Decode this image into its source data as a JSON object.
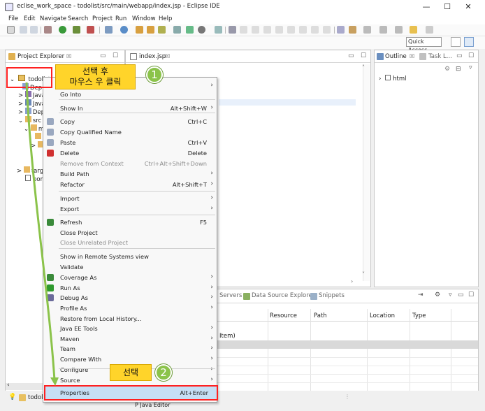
{
  "window": {
    "title": "eclise_work_space - todolist/src/main/webapp/index.jsp - Eclipse IDE",
    "minimize": "—",
    "maximize": "☐",
    "close": "✕"
  },
  "menubar": [
    "File",
    "Edit",
    "Navigate",
    "Search",
    "Project",
    "Run",
    "Window",
    "Help"
  ],
  "toolbar": {
    "quick_access_placeholder": "Quick Access"
  },
  "project_explorer": {
    "tab_label": "Project Explorer",
    "tab_close": "☒",
    "tree": [
      {
        "label": "todolist",
        "expander": "⌄"
      },
      {
        "label": "Dep",
        "expander": ""
      },
      {
        "label": "Java",
        "expander": ">"
      },
      {
        "label": "Java",
        "expander": ">"
      },
      {
        "label": "Dep",
        "expander": ">"
      },
      {
        "label": "src",
        "expander": "⌄"
      },
      {
        "label": "m",
        "expander": "⌄"
      },
      {
        "label": "",
        "expander": ""
      },
      {
        "label": "",
        "expander": ">"
      },
      {
        "label": "targ",
        "expander": ">"
      },
      {
        "label": "pom",
        "expander": ""
      }
    ]
  },
  "editor": {
    "tab_label": "index.jsp",
    "tab_close": "☒"
  },
  "outline": {
    "tab_label": "Outline",
    "tab_close": "☒",
    "tab2_label": "Task L...",
    "tree_item": "html"
  },
  "bottom_panel": {
    "tabs": [
      "Servers",
      "Data Source Explorer",
      "Snippets"
    ],
    "columns": [
      "Resource",
      "Path",
      "Location",
      "Type"
    ],
    "partial_cell": "Item)"
  },
  "context_menu": {
    "items": [
      {
        "label": "",
        "shortcut": "",
        "submenu": true
      },
      {
        "label": "Go Into",
        "shortcut": ""
      },
      {
        "label": "Show In",
        "shortcut": "Alt+Shift+W",
        "submenu": true
      },
      {
        "label": "Copy",
        "shortcut": "Ctrl+C"
      },
      {
        "label": "Copy Qualified Name",
        "shortcut": ""
      },
      {
        "label": "Paste",
        "shortcut": "Ctrl+V"
      },
      {
        "label": "Delete",
        "shortcut": "Delete"
      },
      {
        "label": "Remove from Context",
        "shortcut": "Ctrl+Alt+Shift+Down",
        "disabled": true
      },
      {
        "label": "Build Path",
        "shortcut": "",
        "submenu": true
      },
      {
        "label": "Refactor",
        "shortcut": "Alt+Shift+T",
        "submenu": true
      },
      {
        "label": "Import",
        "shortcut": "",
        "submenu": true
      },
      {
        "label": "Export",
        "shortcut": "",
        "submenu": true
      },
      {
        "label": "Refresh",
        "shortcut": "F5"
      },
      {
        "label": "Close Project",
        "shortcut": ""
      },
      {
        "label": "Close Unrelated Project",
        "shortcut": "",
        "disabled": true
      },
      {
        "label": "Show in Remote Systems view",
        "shortcut": ""
      },
      {
        "label": "Validate",
        "shortcut": ""
      },
      {
        "label": "Coverage As",
        "shortcut": "",
        "submenu": true
      },
      {
        "label": "Run As",
        "shortcut": "",
        "submenu": true
      },
      {
        "label": "Debug As",
        "shortcut": "",
        "submenu": true
      },
      {
        "label": "Profile As",
        "shortcut": "",
        "submenu": true
      },
      {
        "label": "Restore from Local History...",
        "shortcut": ""
      },
      {
        "label": "Java EE Tools",
        "shortcut": "",
        "submenu": true
      },
      {
        "label": "Maven",
        "shortcut": "",
        "submenu": true
      },
      {
        "label": "Team",
        "shortcut": "",
        "submenu": true
      },
      {
        "label": "Compare With",
        "shortcut": "",
        "submenu": true
      },
      {
        "label": "Configure",
        "shortcut": "",
        "submenu": true
      },
      {
        "label": "Source",
        "shortcut": "",
        "submenu": true
      },
      {
        "label": "Properties",
        "shortcut": "Alt+Enter",
        "highlighted": true
      }
    ]
  },
  "annotations": {
    "callout1": {
      "line1": "선택 후",
      "line2": "마우스 우 클릭"
    },
    "badge1": "1",
    "callout2": "선택",
    "badge2": "2",
    "highlight_color": "#ff2020",
    "callout_color": "#ffd42a",
    "badge_color": "#8bc34a"
  },
  "status": {
    "project": "todol",
    "editor_tab": "P Java Editor"
  }
}
